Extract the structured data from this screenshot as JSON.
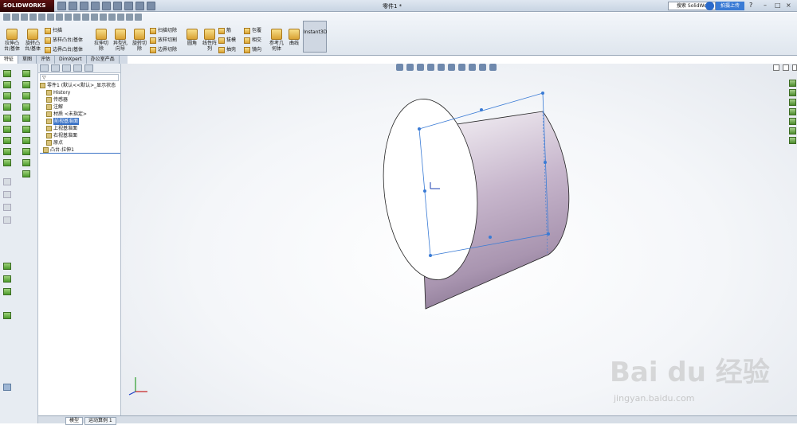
{
  "app": {
    "logo": "SOLIDWORKS",
    "doc_title": "零件1 *"
  },
  "search": {
    "placeholder": "搜索 SolidWorks",
    "upload": "拍摄上传",
    "help": "?"
  },
  "ribbon": {
    "extrude_boss": "拉伸凸台/基体",
    "revolve_boss": "旋转凸台/基体",
    "sweep": "扫描",
    "loft": "放样凸台/基体",
    "boundary": "边界凸台/基体",
    "extrude_cut": "拉伸切除",
    "hole_wizard": "异型孔向导",
    "revolve_cut": "旋转切除",
    "swept_cut": "扫描切除",
    "lofted_cut": "放样切割",
    "boundary_cut": "边界切除",
    "fillet": "圆角",
    "linear_pattern": "线性阵列",
    "rib": "筋",
    "draft": "拔模",
    "shell": "抽壳",
    "wrap": "包覆",
    "intersect": "相交",
    "mirror": "镜向",
    "reference_geometry": "参考几何体",
    "curves": "曲线",
    "instant3d": "Instant3D"
  },
  "tabs": [
    "特征",
    "草图",
    "评估",
    "DimXpert",
    "办公室产品"
  ],
  "tree": {
    "root": "零件1 (默认<<默认>_显示状态",
    "items": [
      "History",
      "传感器",
      "注解",
      "材质 <未指定>",
      "前视基准面",
      "上视基准面",
      "右视基准面",
      "原点",
      "凸台-拉伸1"
    ],
    "selected_index": 4
  },
  "statusbar": {
    "tab_model": "模型",
    "tab_motion": "运动算例 1"
  },
  "watermark": {
    "text": "Bai du 经验",
    "sub": "jingyan.baidu.com"
  },
  "colors": {
    "accent": "#3b73c6",
    "selection": "#3a7bd5"
  }
}
